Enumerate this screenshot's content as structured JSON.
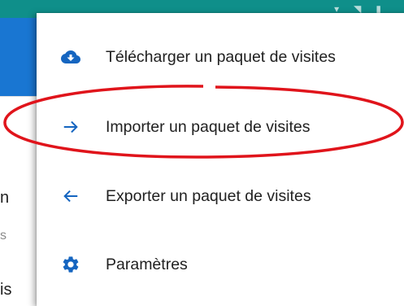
{
  "background": {
    "line1": "n",
    "line2": "s",
    "line3": "is"
  },
  "menu": {
    "items": [
      {
        "label": "Télécharger un paquet de visites",
        "icon": "cloud-download-icon"
      },
      {
        "label": "Importer un paquet de visites",
        "icon": "arrow-right-icon"
      },
      {
        "label": "Exporter un paquet de visites",
        "icon": "arrow-left-icon"
      },
      {
        "label": "Paramètres",
        "icon": "gear-icon"
      }
    ]
  },
  "colors": {
    "status_bar": "#0f8f8a",
    "app_bar": "#1976d2",
    "icon_blue": "#1565c0",
    "highlight_red": "#e0141b"
  }
}
